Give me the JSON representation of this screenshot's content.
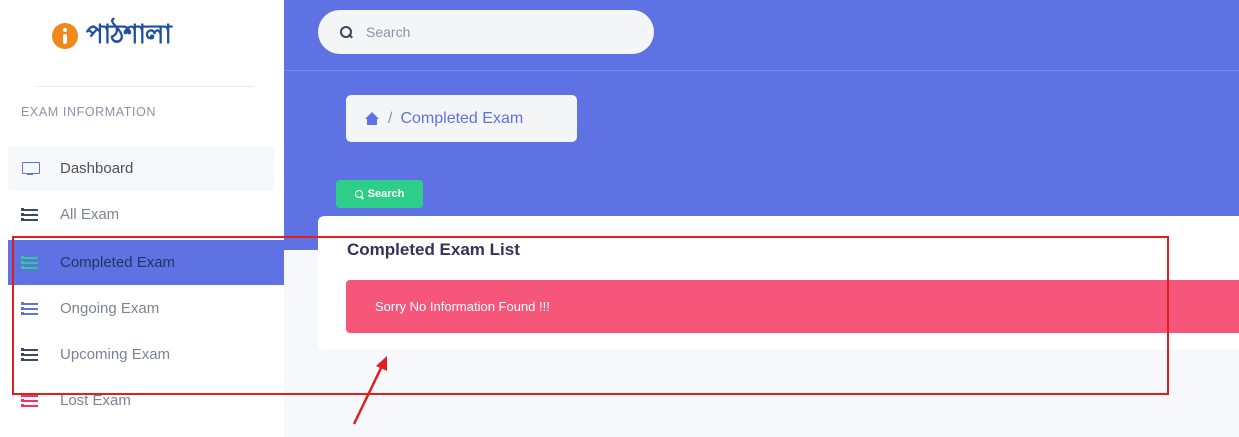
{
  "sidebar": {
    "logo_text": "পাঠশালা",
    "section_heading": "EXAM INFORMATION",
    "items": [
      {
        "label": "Dashboard",
        "icon": "monitor-icon"
      },
      {
        "label": "All Exam",
        "icon": "list-icon"
      },
      {
        "label": "Completed Exam",
        "icon": "list-icon",
        "active": true
      },
      {
        "label": "Ongoing Exam",
        "icon": "list-icon"
      },
      {
        "label": "Upcoming Exam",
        "icon": "list-icon"
      },
      {
        "label": "Lost Exam",
        "icon": "list-icon"
      }
    ]
  },
  "header": {
    "search_placeholder": "Search"
  },
  "breadcrumb": {
    "separator": "/",
    "current": "Completed Exam"
  },
  "toolbar": {
    "search_button_label": "Search"
  },
  "card": {
    "title": "Completed Exam List",
    "alert_message": "Sorry No Information Found !!!"
  },
  "colors": {
    "primary": "#5e72e4",
    "success": "#2dce89",
    "danger": "#f5567a",
    "annotation": "#e02020"
  }
}
